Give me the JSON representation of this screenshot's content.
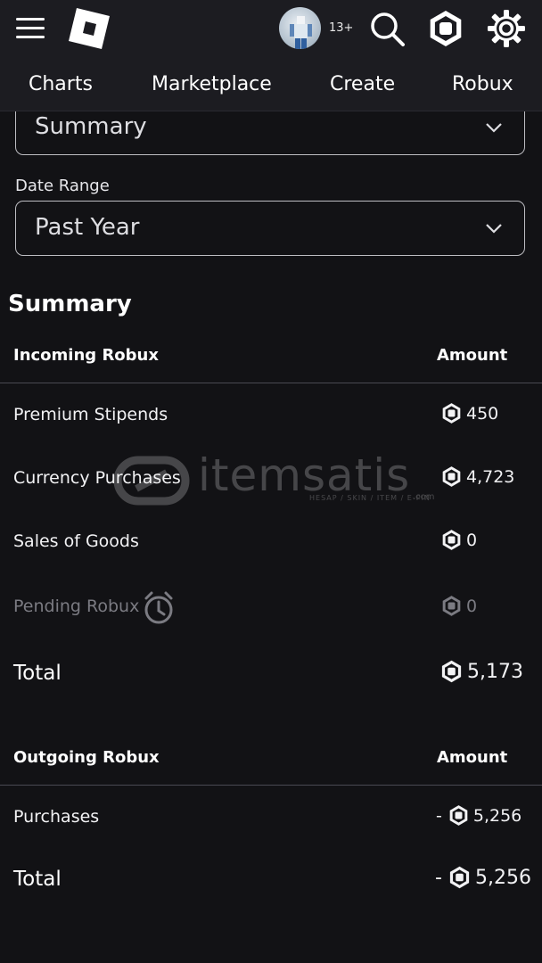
{
  "header": {
    "age_badge": "13+",
    "nav": [
      "Charts",
      "Marketplace",
      "Create",
      "Robux"
    ]
  },
  "filters": {
    "transaction_type_value": "Summary",
    "date_range_label": "Date Range",
    "date_range_value": "Past Year"
  },
  "summary": {
    "title": "Summary",
    "incoming": {
      "header_label": "Incoming Robux",
      "header_amount": "Amount",
      "rows": [
        {
          "label": "Premium Stipends",
          "amount": "450"
        },
        {
          "label": "Currency Purchases",
          "amount": "4,723"
        },
        {
          "label": "Sales of Goods",
          "amount": "0"
        },
        {
          "label": "Pending Robux",
          "amount": "0"
        }
      ],
      "total_label": "Total",
      "total_amount": "5,173"
    },
    "outgoing": {
      "header_label": "Outgoing Robux",
      "header_amount": "Amount",
      "rows": [
        {
          "label": "Purchases",
          "sign": "-",
          "amount": "5,256"
        }
      ],
      "total_label": "Total",
      "total_sign": "-",
      "total_amount": "5,256"
    }
  },
  "watermark": {
    "text": "itemsatis",
    "subtext": "HESAP / SKIN / ITEM / E-PIN",
    "suffix": ".com"
  },
  "icons": {
    "menu": "hamburger-menu-icon",
    "logo": "roblox-logo-icon",
    "search": "search-icon",
    "robux": "robux-icon",
    "settings": "gear-icon",
    "pending": "alarm-clock-icon",
    "chevron": "chevron-down-icon"
  },
  "colors": {
    "background": "#121215",
    "header": "#1c1c21",
    "muted_text": "#7b7b82",
    "border": "#bdbdc2"
  }
}
